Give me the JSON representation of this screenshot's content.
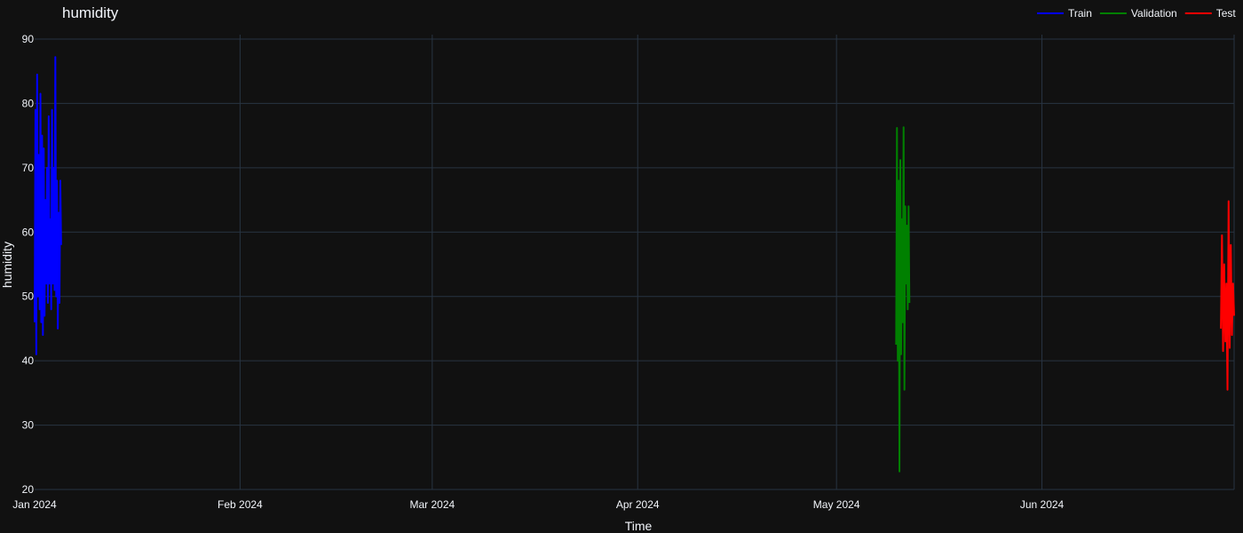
{
  "chart_data": {
    "type": "line",
    "title": "humidity",
    "xlabel": "Time",
    "ylabel": "humidity",
    "x_axis_type": "date",
    "xlim": [
      "2024-01-01",
      "2024-06-30"
    ],
    "ylim": [
      20,
      90
    ],
    "yticks": [
      20,
      30,
      40,
      50,
      60,
      70,
      80,
      90
    ],
    "xticks": [
      {
        "date": "2024-01-01",
        "label": "Jan 2024"
      },
      {
        "date": "2024-02-01",
        "label": "Feb 2024"
      },
      {
        "date": "2024-03-01",
        "label": "Mar 2024"
      },
      {
        "date": "2024-04-01",
        "label": "Apr 2024"
      },
      {
        "date": "2024-05-01",
        "label": "May 2024"
      },
      {
        "date": "2024-06-01",
        "label": "Jun 2024"
      }
    ],
    "grid": true,
    "legend_position": "top-right",
    "series": [
      {
        "name": "Train",
        "color": "#0000ff",
        "x": [
          "2024-01-01T00:00",
          "2024-01-01T03:00",
          "2024-01-01T06:00",
          "2024-01-01T09:00",
          "2024-01-01T12:00",
          "2024-01-01T15:00",
          "2024-01-01T18:00",
          "2024-01-01T21:00",
          "2024-01-02T00:00",
          "2024-01-02T03:00",
          "2024-01-02T06:00",
          "2024-01-02T09:00",
          "2024-01-02T12:00",
          "2024-01-02T15:00",
          "2024-01-02T18:00",
          "2024-01-02T21:00",
          "2024-01-03T00:00",
          "2024-01-03T03:00",
          "2024-01-03T06:00",
          "2024-01-03T09:00",
          "2024-01-03T12:00",
          "2024-01-03T15:00",
          "2024-01-03T18:00",
          "2024-01-03T21:00",
          "2024-01-04T00:00",
          "2024-01-04T03:00",
          "2024-01-04T06:00",
          "2024-01-04T09:00",
          "2024-01-04T12:00",
          "2024-01-04T15:00",
          "2024-01-04T18:00",
          "2024-01-04T21:00",
          "2024-01-05T00:00"
        ],
        "y": [
          46,
          79,
          41,
          84.5,
          50,
          72,
          48,
          81.5,
          46,
          75,
          44,
          73,
          47,
          65,
          52,
          70,
          49,
          78,
          52,
          62,
          48,
          79,
          52,
          70,
          51,
          87.2,
          50,
          68,
          45,
          63,
          49,
          68,
          58
        ]
      },
      {
        "name": "Validation",
        "color": "#008000",
        "x": [
          "2024-05-10T00:00",
          "2024-05-10T03:00",
          "2024-05-10T06:00",
          "2024-05-10T09:00",
          "2024-05-10T12:00",
          "2024-05-10T15:00",
          "2024-05-10T18:00",
          "2024-05-10T21:00",
          "2024-05-11T00:00",
          "2024-05-11T03:00",
          "2024-05-11T06:00",
          "2024-05-11T09:00",
          "2024-05-11T12:00",
          "2024-05-11T15:00",
          "2024-05-11T18:00",
          "2024-05-11T21:00",
          "2024-05-12T00:00"
        ],
        "y": [
          42.5,
          76.2,
          40,
          68,
          22.8,
          71.2,
          41,
          62,
          46,
          76.3,
          35.5,
          64,
          52,
          61,
          48,
          64,
          49
        ]
      },
      {
        "name": "Test",
        "color": "#ff0000",
        "x": [
          "2024-06-28T00:00",
          "2024-06-28T04:00",
          "2024-06-28T08:00",
          "2024-06-28T12:00",
          "2024-06-28T16:00",
          "2024-06-28T20:00",
          "2024-06-29T00:00",
          "2024-06-29T04:00",
          "2024-06-29T08:00",
          "2024-06-29T12:00",
          "2024-06-29T16:00",
          "2024-06-29T20:00",
          "2024-06-30T00:00"
        ],
        "y": [
          45,
          59.5,
          41.5,
          55,
          43,
          52,
          35.5,
          64.8,
          42,
          58,
          44,
          52,
          47
        ]
      }
    ]
  }
}
